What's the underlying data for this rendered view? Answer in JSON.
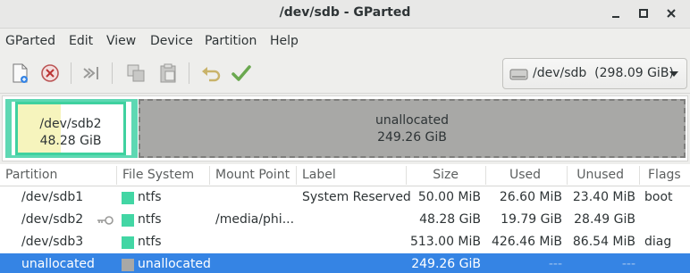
{
  "window": {
    "title": "/dev/sdb - GParted"
  },
  "menu": [
    "GParted",
    "Edit",
    "View",
    "Device",
    "Partition",
    "Help"
  ],
  "toolbar": {
    "icons": [
      "new-partition-icon",
      "delete-partition-icon",
      "resize-move-icon",
      "copy-icon",
      "paste-icon",
      "undo-icon",
      "apply-icon"
    ]
  },
  "device_selector": {
    "label": "/dev/sdb  (298.09 GiB)"
  },
  "disk_map": {
    "partition": {
      "name": "/dev/sdb2",
      "size": "48.28 GiB",
      "used_fraction": 0.41
    },
    "unallocated": {
      "name": "unallocated",
      "size": "249.26 GiB"
    }
  },
  "table": {
    "headers": [
      "Partition",
      "File System",
      "Mount Point",
      "Label",
      "Size",
      "Used",
      "Unused",
      "Flags"
    ],
    "rows": [
      {
        "partition": "/dev/sdb1",
        "fs": "ntfs",
        "fs_color": "#42d6a4",
        "mount": "",
        "label": "System Reserved",
        "size": "50.00 MiB",
        "used": "26.60 MiB",
        "unused": "23.40 MiB",
        "flags": "boot",
        "key_icon": false
      },
      {
        "partition": "/dev/sdb2",
        "fs": "ntfs",
        "fs_color": "#42d6a4",
        "mount": "/media/phi...",
        "label": "",
        "size": "48.28 GiB",
        "used": "19.79 GiB",
        "unused": "28.49 GiB",
        "flags": "",
        "key_icon": true
      },
      {
        "partition": "/dev/sdb3",
        "fs": "ntfs",
        "fs_color": "#42d6a4",
        "mount": "",
        "label": "",
        "size": "513.00 MiB",
        "used": "426.46 MiB",
        "unused": "86.54 MiB",
        "flags": "diag",
        "key_icon": false
      },
      {
        "partition": "unallocated",
        "fs": "unallocated",
        "fs_color": "#a8a8a6",
        "mount": "",
        "label": "",
        "size": "249.26 GiB",
        "used": "---",
        "unused": "---",
        "flags": "",
        "key_icon": false
      }
    ]
  }
}
